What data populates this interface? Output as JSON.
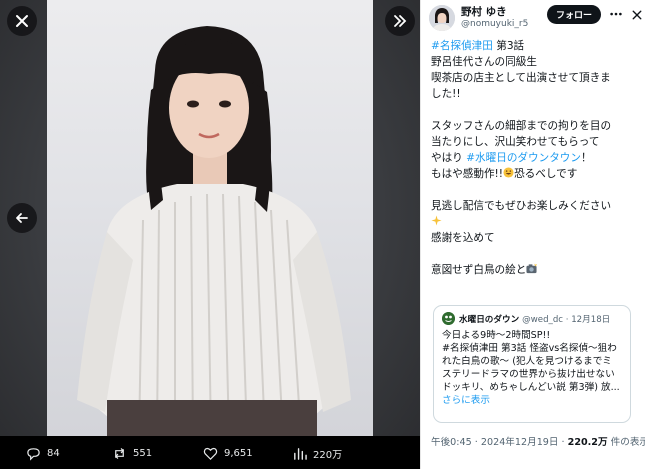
{
  "viewer": {
    "icons": {
      "close": "close-icon",
      "next": "double-chevron-right-icon",
      "prev": "arrow-left-icon"
    },
    "actions": {
      "replies": "84",
      "reposts": "551",
      "likes": "9,651",
      "views": "220万"
    }
  },
  "post": {
    "author_name": "野村 ゆき",
    "author_handle": "@nomuyuki_r5",
    "follow_label": "フォロー",
    "text": {
      "l1_tag": "#名探偵津田",
      "l1_rest": " 第3話",
      "l2": "野呂佳代さんの同級生",
      "l3": "喫茶店の店主として出演させて頂きま",
      "l4": "した!!",
      "l5": "スタッフさんの細部までの拘りを目の",
      "l6": "当たりにし、沢山笑わせてもらって",
      "l7_pre": "やはり ",
      "l7_tag": "#水曜日のダウンタウン",
      "l7_post": "！",
      "l8_pre": "もはや感動作!!",
      "l8_post": "恐るべしです",
      "l9": "見逃し配信でもぜひお楽しみください",
      "l10": "感謝を込めて",
      "l11": "意図せず白鳥の絵と"
    },
    "quote": {
      "name": "水曜日のダウン",
      "handle": "@wed_dc · 12月18日",
      "lines": [
        "今日よる9時〜2時間SP!!",
        "#名探偵津田 第3話 怪盗vs名探偵〜狙わ",
        "れた白鳥の歌〜 (犯人を見つけるまでミ",
        "ステリードラマの世界から抜け出せない",
        "ドッキリ、めちゃしんどい説 第3弾) 放..."
      ],
      "show_more": "さらに表示"
    },
    "meta": {
      "time": "午後0:45 · 2024年12月19日 · ",
      "views": "220.2万",
      "views_suffix": " 件の表示"
    }
  },
  "colors": {
    "accent": "#1d9bf0",
    "text": "#0f1419",
    "muted": "#536471",
    "follow_bg": "#0f1419"
  }
}
